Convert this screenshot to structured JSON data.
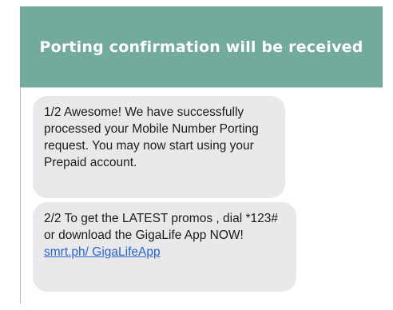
{
  "header": {
    "title": "Porting confirmation will be received"
  },
  "messages": [
    {
      "text": "1/2 Awesome! We have successfully processed your Mobile Number Porting request. You may now start using your Prepaid account."
    },
    {
      "text": "2/2 To get the LATEST promos , dial *123# or download the GigaLife App NOW! ",
      "link_text": "smrt.ph/ GigaLifeApp"
    }
  ],
  "colors": {
    "header_bg": "#73aa9e",
    "bubble_bg": "#e9e9eb",
    "link": "#2b63d9"
  }
}
